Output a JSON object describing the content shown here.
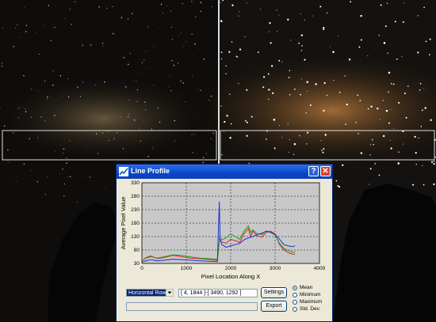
{
  "window": {
    "title": "Line Profile",
    "help_label": "?",
    "close_label": "✕"
  },
  "chart_data": {
    "type": "line",
    "xlabel": "Pixel Location Along X",
    "ylabel": "Average Pixel Value",
    "xlim": [
      0,
      4000
    ],
    "ylim": [
      30,
      330
    ],
    "xticks": [
      "0",
      "1000",
      "2000",
      "3000",
      "4000"
    ],
    "yticks": [
      "30",
      "80",
      "130",
      "180",
      "230",
      "280",
      "330"
    ],
    "grid": true,
    "series": [
      {
        "color": "#e02020",
        "points": [
          [
            0,
            40
          ],
          [
            100,
            52
          ],
          [
            200,
            58
          ],
          [
            350,
            48
          ],
          [
            500,
            52
          ],
          [
            700,
            60
          ],
          [
            900,
            55
          ],
          [
            1100,
            50
          ],
          [
            1300,
            48
          ],
          [
            1500,
            45
          ],
          [
            1700,
            42
          ],
          [
            1750,
            120
          ],
          [
            1800,
            110
          ],
          [
            1900,
            105
          ],
          [
            2000,
            120
          ],
          [
            2100,
            115
          ],
          [
            2200,
            108
          ],
          [
            2300,
            140
          ],
          [
            2400,
            160
          ],
          [
            2450,
            130
          ],
          [
            2500,
            150
          ],
          [
            2600,
            132
          ],
          [
            2700,
            128
          ],
          [
            2800,
            145
          ],
          [
            2900,
            150
          ],
          [
            3000,
            140
          ],
          [
            3100,
            100
          ],
          [
            3200,
            80
          ],
          [
            3300,
            70
          ],
          [
            3400,
            64
          ],
          [
            3450,
            66
          ]
        ]
      },
      {
        "color": "#20a020",
        "points": [
          [
            0,
            42
          ],
          [
            100,
            50
          ],
          [
            200,
            55
          ],
          [
            350,
            50
          ],
          [
            500,
            55
          ],
          [
            700,
            62
          ],
          [
            900,
            60
          ],
          [
            1100,
            54
          ],
          [
            1300,
            50
          ],
          [
            1500,
            48
          ],
          [
            1700,
            45
          ],
          [
            1750,
            125
          ],
          [
            1800,
            118
          ],
          [
            1900,
            125
          ],
          [
            2000,
            140
          ],
          [
            2100,
            130
          ],
          [
            2200,
            120
          ],
          [
            2300,
            150
          ],
          [
            2400,
            170
          ],
          [
            2450,
            145
          ],
          [
            2500,
            155
          ],
          [
            2600,
            140
          ],
          [
            2700,
            138
          ],
          [
            2800,
            150
          ],
          [
            2900,
            148
          ],
          [
            3000,
            135
          ],
          [
            3100,
            105
          ],
          [
            3200,
            86
          ],
          [
            3300,
            78
          ],
          [
            3400,
            72
          ],
          [
            3450,
            74
          ]
        ]
      },
      {
        "color": "#1830d8",
        "points": [
          [
            0,
            36
          ],
          [
            100,
            40
          ],
          [
            200,
            44
          ],
          [
            350,
            40
          ],
          [
            500,
            42
          ],
          [
            700,
            46
          ],
          [
            900,
            44
          ],
          [
            1100,
            42
          ],
          [
            1300,
            40
          ],
          [
            1500,
            38
          ],
          [
            1700,
            37
          ],
          [
            1745,
            260
          ],
          [
            1760,
            120
          ],
          [
            1800,
            100
          ],
          [
            1900,
            90
          ],
          [
            2000,
            96
          ],
          [
            2100,
            100
          ],
          [
            2200,
            104
          ],
          [
            2300,
            118
          ],
          [
            2400,
            125
          ],
          [
            2500,
            130
          ],
          [
            2600,
            138
          ],
          [
            2700,
            142
          ],
          [
            2800,
            150
          ],
          [
            2900,
            145
          ],
          [
            3000,
            138
          ],
          [
            3100,
            120
          ],
          [
            3200,
            100
          ],
          [
            3300,
            95
          ],
          [
            3400,
            92
          ],
          [
            3450,
            96
          ]
        ]
      }
    ]
  },
  "controls": {
    "orientation_select": "Horizontal Row",
    "coordinates": "[ 4, 1844 ]-[ 3490, 1292 ]",
    "settings_label": "Settings",
    "export_label": "Export",
    "radio_options": [
      "Mean",
      "Minimum",
      "Maximum",
      "Std. Dev."
    ],
    "selected_radio": "Mean"
  }
}
